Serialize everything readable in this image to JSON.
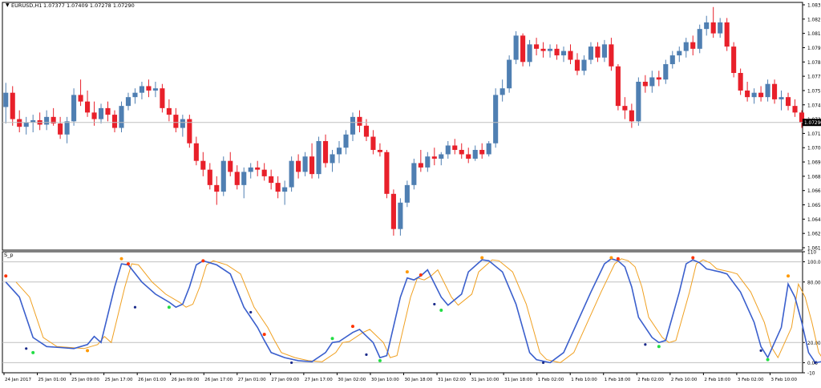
{
  "header": {
    "symbol": "EURUSD,H1",
    "ohlc": "1.07377 1.07409 1.07278 1.07290",
    "indicator_label": "S_p"
  },
  "colors": {
    "bull": "#4f7fb2",
    "bear": "#e8202a",
    "main_line": "#3a5fcd",
    "signal_line": "#f0a020",
    "marker_green": "#22dd44",
    "marker_red": "#ff3300",
    "marker_orange": "#ff9900",
    "marker_navy": "#1a2a8a",
    "grid": "#c0c0c0",
    "price_tag": "#000000"
  },
  "chart_data": [
    {
      "type": "candlestick",
      "name": "price",
      "y_ticks": [
        "1.08360",
        "1.08230",
        "1.08100",
        "1.07970",
        "1.07840",
        "1.07710",
        "1.07580",
        "1.07450",
        "1.07320",
        "1.07190",
        "1.07060",
        "1.06930",
        "1.06800",
        "1.06670",
        "1.06540",
        "1.06410",
        "1.06280",
        "1.06150"
      ],
      "current_price": "1.07290",
      "ylim": [
        1.0615,
        1.0836
      ],
      "candles": [
        [
          1.0743,
          1.0765,
          1.0728,
          1.0756
        ],
        [
          1.0756,
          1.0762,
          1.0726,
          1.0732
        ],
        [
          1.0732,
          1.074,
          1.072,
          1.0725
        ],
        [
          1.0725,
          1.0734,
          1.0718,
          1.0729
        ],
        [
          1.0729,
          1.0736,
          1.072,
          1.0731
        ],
        [
          1.0731,
          1.0738,
          1.0722,
          1.0727
        ],
        [
          1.0727,
          1.074,
          1.0722,
          1.0734
        ],
        [
          1.0734,
          1.0742,
          1.0726,
          1.0728
        ],
        [
          1.0728,
          1.0734,
          1.0714,
          1.0718
        ],
        [
          1.0718,
          1.0734,
          1.071,
          1.073
        ],
        [
          1.073,
          1.076,
          1.0726,
          1.0754
        ],
        [
          1.0754,
          1.0768,
          1.0744,
          1.0748
        ],
        [
          1.0748,
          1.0758,
          1.0734,
          1.0738
        ],
        [
          1.0738,
          1.0748,
          1.0726,
          1.0732
        ],
        [
          1.0732,
          1.0746,
          1.0728,
          1.0742
        ],
        [
          1.0742,
          1.0748,
          1.073,
          1.0736
        ],
        [
          1.0736,
          1.074,
          1.072,
          1.0724
        ],
        [
          1.0724,
          1.0748,
          1.072,
          1.0744
        ],
        [
          1.0744,
          1.0756,
          1.074,
          1.0752
        ],
        [
          1.0752,
          1.076,
          1.0746,
          1.0756
        ],
        [
          1.0756,
          1.0766,
          1.075,
          1.0762
        ],
        [
          1.0762,
          1.0768,
          1.0752,
          1.0758
        ],
        [
          1.0758,
          1.0766,
          1.0752,
          1.076
        ],
        [
          1.076,
          1.0764,
          1.0738,
          1.0742
        ],
        [
          1.0742,
          1.075,
          1.073,
          1.0736
        ],
        [
          1.0736,
          1.0742,
          1.072,
          1.0724
        ],
        [
          1.0724,
          1.0736,
          1.0716,
          1.0732
        ],
        [
          1.0732,
          1.0736,
          1.0706,
          1.071
        ],
        [
          1.071,
          1.0716,
          1.069,
          1.0694
        ],
        [
          1.0694,
          1.0702,
          1.068,
          1.0686
        ],
        [
          1.0686,
          1.0692,
          1.0668,
          1.0672
        ],
        [
          1.0672,
          1.068,
          1.0654,
          1.0666
        ],
        [
          1.0666,
          1.0698,
          1.0662,
          1.0694
        ],
        [
          1.0694,
          1.0702,
          1.068,
          1.0684
        ],
        [
          1.0684,
          1.069,
          1.0668,
          1.0672
        ],
        [
          1.0672,
          1.0688,
          1.066,
          1.0684
        ],
        [
          1.0684,
          1.0692,
          1.0678,
          1.0688
        ],
        [
          1.0688,
          1.0694,
          1.068,
          1.0686
        ],
        [
          1.0686,
          1.0692,
          1.0676,
          1.068
        ],
        [
          1.068,
          1.0686,
          1.0668,
          1.0674
        ],
        [
          1.0674,
          1.068,
          1.066,
          1.0666
        ],
        [
          1.0666,
          1.0676,
          1.0654,
          1.067
        ],
        [
          1.067,
          1.0698,
          1.0666,
          1.0694
        ],
        [
          1.0694,
          1.07,
          1.0678,
          1.0684
        ],
        [
          1.0684,
          1.0702,
          1.068,
          1.0698
        ],
        [
          1.0698,
          1.071,
          1.0678,
          1.0682
        ],
        [
          1.0682,
          1.0716,
          1.0678,
          1.0712
        ],
        [
          1.0712,
          1.0718,
          1.0688,
          1.0692
        ],
        [
          1.0692,
          1.0704,
          1.0684,
          1.07
        ],
        [
          1.07,
          1.0712,
          1.0692,
          1.0706
        ],
        [
          1.0706,
          1.0722,
          1.07,
          1.0718
        ],
        [
          1.0718,
          1.0738,
          1.0712,
          1.0734
        ],
        [
          1.0734,
          1.074,
          1.072,
          1.0726
        ],
        [
          1.0726,
          1.0732,
          1.0712,
          1.0716
        ],
        [
          1.0716,
          1.0722,
          1.07,
          1.0704
        ],
        [
          1.0704,
          1.071,
          1.0698,
          1.0702
        ],
        [
          1.0702,
          1.0704,
          1.066,
          1.0664
        ],
        [
          1.0664,
          1.0668,
          1.0626,
          1.0632
        ],
        [
          1.0632,
          1.066,
          1.0626,
          1.0656
        ],
        [
          1.0656,
          1.0676,
          1.0652,
          1.0672
        ],
        [
          1.0672,
          1.0696,
          1.0668,
          1.0692
        ],
        [
          1.0692,
          1.0704,
          1.0684,
          1.0688
        ],
        [
          1.0688,
          1.0702,
          1.0684,
          1.0698
        ],
        [
          1.0698,
          1.0706,
          1.069,
          1.0696
        ],
        [
          1.0696,
          1.0702,
          1.069,
          1.07
        ],
        [
          1.07,
          1.0712,
          1.0696,
          1.0708
        ],
        [
          1.0708,
          1.0714,
          1.07,
          1.0704
        ],
        [
          1.0704,
          1.071,
          1.0696,
          1.07
        ],
        [
          1.07,
          1.0706,
          1.0692,
          1.0696
        ],
        [
          1.0696,
          1.0708,
          1.0694,
          1.0704
        ],
        [
          1.0704,
          1.071,
          1.0696,
          1.07
        ],
        [
          1.07,
          1.0712,
          1.0698,
          1.071
        ],
        [
          1.071,
          1.076,
          1.0706,
          1.0754
        ],
        [
          1.0754,
          1.0768,
          1.0748,
          1.076
        ],
        [
          1.076,
          1.079,
          1.0756,
          1.0786
        ],
        [
          1.0786,
          1.0812,
          1.0782,
          1.0808
        ],
        [
          1.0808,
          1.081,
          1.078,
          1.0784
        ],
        [
          1.0784,
          1.0804,
          1.078,
          1.08
        ],
        [
          1.08,
          1.0806,
          1.079,
          1.0796
        ],
        [
          1.0796,
          1.0802,
          1.0788,
          1.0794
        ],
        [
          1.0794,
          1.08,
          1.0788,
          1.0796
        ],
        [
          1.0796,
          1.08,
          1.0786,
          1.079
        ],
        [
          1.079,
          1.0798,
          1.0784,
          1.0794
        ],
        [
          1.0794,
          1.08,
          1.0782,
          1.0786
        ],
        [
          1.0786,
          1.0792,
          1.0772,
          1.0776
        ],
        [
          1.0776,
          1.079,
          1.0772,
          1.0786
        ],
        [
          1.0786,
          1.0802,
          1.0782,
          1.0798
        ],
        [
          1.0798,
          1.0802,
          1.0784,
          1.0788
        ],
        [
          1.0788,
          1.0804,
          1.0784,
          1.08
        ],
        [
          1.08,
          1.0806,
          1.0776,
          1.078
        ],
        [
          1.078,
          1.0782,
          1.074,
          1.0744
        ],
        [
          1.0744,
          1.0752,
          1.0732,
          1.074
        ],
        [
          1.074,
          1.0746,
          1.0724,
          1.073
        ],
        [
          1.073,
          1.077,
          1.0726,
          1.0766
        ],
        [
          1.0766,
          1.0772,
          1.0756,
          1.0762
        ],
        [
          1.0762,
          1.0776,
          1.0756,
          1.077
        ],
        [
          1.077,
          1.0776,
          1.0762,
          1.0768
        ],
        [
          1.0768,
          1.0786,
          1.0764,
          1.0782
        ],
        [
          1.0782,
          1.0794,
          1.0778,
          1.079
        ],
        [
          1.079,
          1.0798,
          1.0784,
          1.0794
        ],
        [
          1.0794,
          1.0806,
          1.0788,
          1.0802
        ],
        [
          1.0802,
          1.0808,
          1.079,
          1.0796
        ],
        [
          1.0796,
          1.0818,
          1.0792,
          1.0814
        ],
        [
          1.0814,
          1.0826,
          1.0808,
          1.082
        ],
        [
          1.082,
          1.0834,
          1.0806,
          1.081
        ],
        [
          1.081,
          1.0824,
          1.0806,
          1.082
        ],
        [
          1.082,
          1.0824,
          1.0794,
          1.0798
        ],
        [
          1.0798,
          1.0802,
          1.077,
          1.0774
        ],
        [
          1.0774,
          1.0778,
          1.0754,
          1.0758
        ],
        [
          1.0758,
          1.0766,
          1.0748,
          1.0752
        ],
        [
          1.0752,
          1.076,
          1.0746,
          1.0756
        ],
        [
          1.0756,
          1.0762,
          1.0748,
          1.0752
        ],
        [
          1.0752,
          1.0768,
          1.0748,
          1.0764
        ],
        [
          1.0764,
          1.0768,
          1.0746,
          1.075
        ],
        [
          1.075,
          1.0758,
          1.074,
          1.0752
        ],
        [
          1.0752,
          1.0756,
          1.074,
          1.0744
        ],
        [
          1.0744,
          1.075,
          1.0734,
          1.0738
        ],
        [
          1.0738,
          1.074,
          1.0724,
          1.0729
        ]
      ]
    },
    {
      "type": "line",
      "name": "S_p",
      "y_ticks": [
        "110",
        "100.00",
        "80.00",
        "20.00",
        "0.00",
        "-10"
      ],
      "ylim": [
        -10,
        110
      ],
      "levels": [
        100,
        80,
        20,
        0
      ],
      "x_ticks": [
        "24 Jan 2017",
        "25 Jan 01:00",
        "25 Jan 09:00",
        "25 Jan 17:00",
        "26 Jan 01:00",
        "26 Jan 09:00",
        "26 Jan 17:00",
        "27 Jan 01:00",
        "27 Jan 09:00",
        "27 Jan 17:00",
        "30 Jan 02:00",
        "30 Jan 10:00",
        "30 Jan 18:00",
        "31 Jan 02:00",
        "31 Jan 10:00",
        "31 Jan 18:00",
        "1 Feb 02:00",
        "1 Feb 10:00",
        "1 Feb 18:00",
        "2 Feb 02:00",
        "2 Feb 10:00",
        "2 Feb 18:00",
        "3 Feb 02:00",
        "3 Feb 10:00"
      ],
      "main_points": [
        [
          0,
          80
        ],
        [
          2,
          65
        ],
        [
          4,
          25
        ],
        [
          6,
          16
        ],
        [
          8,
          15
        ],
        [
          10,
          14
        ],
        [
          12,
          18
        ],
        [
          13,
          26
        ],
        [
          14,
          20
        ],
        [
          16,
          75
        ],
        [
          17,
          98
        ],
        [
          18,
          97
        ],
        [
          20,
          80
        ],
        [
          22,
          68
        ],
        [
          24,
          60
        ],
        [
          25,
          55
        ],
        [
          26,
          58
        ],
        [
          27,
          75
        ],
        [
          28,
          97
        ],
        [
          29,
          101
        ],
        [
          31,
          97
        ],
        [
          33,
          88
        ],
        [
          35,
          55
        ],
        [
          37,
          35
        ],
        [
          38,
          22
        ],
        [
          39,
          10
        ],
        [
          41,
          5
        ],
        [
          43,
          2
        ],
        [
          45,
          1
        ],
        [
          47,
          10
        ],
        [
          48,
          20
        ],
        [
          49,
          21
        ],
        [
          51,
          30
        ],
        [
          52,
          33
        ],
        [
          54,
          20
        ],
        [
          55,
          5
        ],
        [
          56,
          7
        ],
        [
          58,
          65
        ],
        [
          59,
          84
        ],
        [
          60,
          82
        ],
        [
          61,
          86
        ],
        [
          62,
          92
        ],
        [
          64,
          65
        ],
        [
          65,
          57
        ],
        [
          67,
          68
        ],
        [
          68,
          90
        ],
        [
          70,
          102
        ],
        [
          71,
          101
        ],
        [
          73,
          90
        ],
        [
          75,
          58
        ],
        [
          77,
          10
        ],
        [
          78,
          3
        ],
        [
          80,
          0
        ],
        [
          82,
          10
        ],
        [
          84,
          40
        ],
        [
          86,
          70
        ],
        [
          88,
          98
        ],
        [
          89,
          103
        ],
        [
          90,
          101
        ],
        [
          91,
          95
        ],
        [
          92,
          75
        ],
        [
          93,
          45
        ],
        [
          95,
          25
        ],
        [
          96,
          20
        ],
        [
          97,
          22
        ],
        [
          99,
          70
        ],
        [
          100,
          98
        ],
        [
          101,
          102
        ],
        [
          102,
          99
        ],
        [
          103,
          93
        ],
        [
          105,
          90
        ],
        [
          106,
          88
        ],
        [
          108,
          70
        ],
        [
          110,
          40
        ],
        [
          111,
          16
        ],
        [
          112,
          5
        ],
        [
          114,
          35
        ],
        [
          115,
          78
        ],
        [
          116,
          65
        ],
        [
          117,
          40
        ],
        [
          118,
          10
        ],
        [
          119,
          0
        ],
        [
          121,
          2
        ],
        [
          123,
          45
        ],
        [
          125,
          90
        ],
        [
          126,
          99
        ],
        [
          127,
          97
        ],
        [
          128,
          93
        ],
        [
          129,
          95
        ],
        [
          130,
          92
        ],
        [
          131,
          85
        ],
        [
          133,
          92
        ],
        [
          134,
          86
        ],
        [
          136,
          40
        ],
        [
          137,
          5
        ],
        [
          138,
          0
        ],
        [
          140,
          1
        ],
        [
          142,
          5
        ],
        [
          144,
          9
        ],
        [
          145,
          7
        ],
        [
          146,
          12
        ],
        [
          147,
          9
        ],
        [
          148,
          3
        ],
        [
          149,
          0
        ]
      ],
      "signal_lag": 1.5
    }
  ],
  "markers": [
    [
      0,
      86,
      "red"
    ],
    [
      4,
      10,
      "green"
    ],
    [
      12,
      12,
      "orange"
    ],
    [
      17,
      103,
      "orange"
    ],
    [
      18,
      98,
      "red"
    ],
    [
      24,
      55,
      "green"
    ],
    [
      29,
      101,
      "red"
    ],
    [
      38,
      28,
      "red"
    ],
    [
      48,
      24,
      "green"
    ],
    [
      51,
      36,
      "red"
    ],
    [
      55,
      2,
      "green"
    ],
    [
      59,
      90,
      "orange"
    ],
    [
      61,
      87,
      "red"
    ],
    [
      64,
      52,
      "green"
    ],
    [
      70,
      104,
      "orange"
    ],
    [
      89,
      104,
      "orange"
    ],
    [
      90,
      103,
      "red"
    ],
    [
      96,
      16,
      "green"
    ],
    [
      101,
      104,
      "red"
    ],
    [
      112,
      3,
      "green"
    ],
    [
      115,
      86,
      "orange"
    ],
    [
      126,
      101,
      "orange"
    ],
    [
      127,
      98,
      "red"
    ],
    [
      128,
      86,
      "green"
    ],
    [
      134,
      98,
      "red"
    ],
    [
      145,
      7,
      "green"
    ],
    [
      146,
      17,
      "orange"
    ],
    [
      147,
      15,
      "red"
    ]
  ]
}
